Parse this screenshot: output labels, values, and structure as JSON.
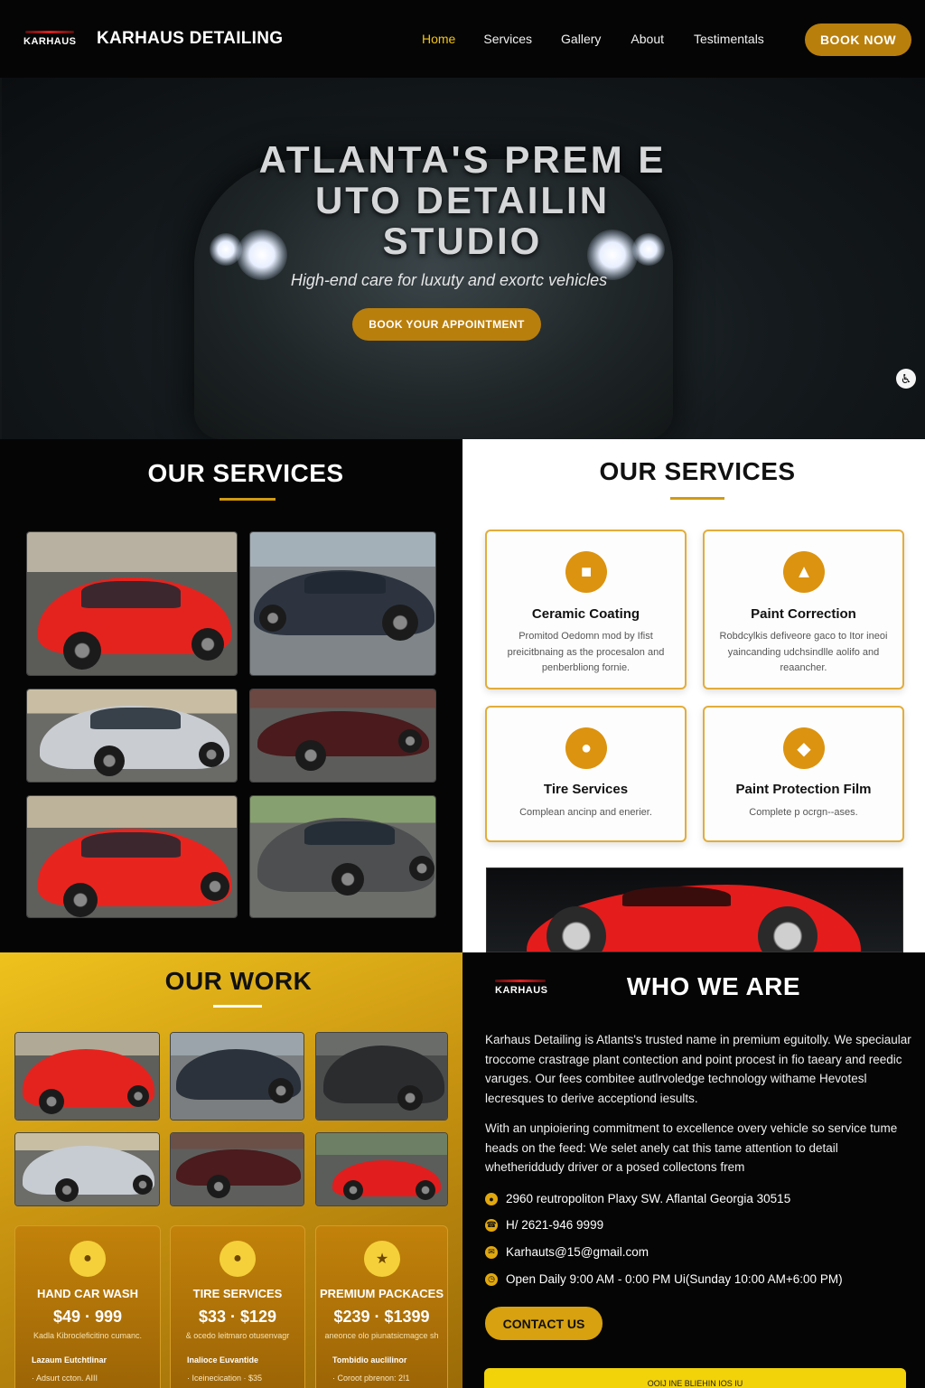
{
  "nav": {
    "logo_text": "KARHAUS",
    "brand": "KARHAUS DETAILING",
    "items": [
      {
        "label": "Home",
        "active": true
      },
      {
        "label": "Services",
        "active": false
      },
      {
        "label": "Gallery",
        "active": false
      },
      {
        "label": "About",
        "active": false
      },
      {
        "label": "Testimentals",
        "active": false
      }
    ],
    "cta": "BOOK NOW"
  },
  "hero": {
    "title_line1": "ATLANTA'S PREM  E",
    "title_line2": "UTO DETAILIN",
    "title_line3": "STUDIO",
    "subtitle": "High-end care for luxuty and exortc vehicles",
    "cta": "BOOK YOUR APPOINTMENT",
    "accessibility_icon": "accessibility-icon"
  },
  "services_left": {
    "title": "OUR SERVICES"
  },
  "services_right": {
    "title": "OUR SERVICES",
    "cards": [
      {
        "title": "Ceramic Coating",
        "desc": "Promitod Oedomn mod by Ifist preicitbnaing as the procesalon and penberbliong fornie.",
        "icon": "shield-icon"
      },
      {
        "title": "Paint Correction",
        "desc": "Robdcylkis defiveore gaco to Itor ineoi yaincanding udchsindlle aolifo and reaancher.",
        "icon": "spray-icon"
      },
      {
        "title": "Tire Services",
        "desc": "Complean ancinp and enerier.",
        "icon": "car-icon"
      },
      {
        "title": "Paint Protection Film",
        "desc": "Complete p ocrgn--ases.",
        "icon": "film-icon"
      }
    ]
  },
  "work": {
    "title": "OUR WORK",
    "packages": [
      {
        "name": "HAND CAR WASH",
        "price": "$49 · 999",
        "desc": "Kadla Kibrocleficitino cumanc.",
        "feature1": "Lazaum Eutchtlinar",
        "feature2": "·  Adsurt    ccton.   AIII",
        "icon": "wash-icon"
      },
      {
        "name": "TIRE SERVICES",
        "price": "$33 · $129",
        "desc": "& ocedo leitmaro otusenvagr",
        "feature1": "Inalioce Euvantide",
        "feature2": "·  Iceinecication    · $35",
        "icon": "tire-icon"
      },
      {
        "name": "PREMIUM PACKACES",
        "price": "$239 · $1399",
        "desc": "aneonce olo piunatsicmagce sh",
        "feature1": "Tombidio auclilinor",
        "feature2": "·  Coroot   pbrenon:   2!1",
        "icon": "star-icon"
      }
    ]
  },
  "who": {
    "logo_text": "KARHAUS",
    "title": "WHO WE ARE",
    "para1": "Karhaus Detailing is  Atlants's trusted name in premium eguitolly. We speciaular troccome crastrage  plant contection  and point procest in fio taeary and reedic varuges. Our fees combitee autlrvoledge  technology withame  Hevotesl lecresques to derive acceptiond iesults.",
    "para2": "With an unpioiering commitment to excellence  overy vehicle so service tume heads on the feed: We selet anely cat this tame attention to detail whetheriddudy driver or a posed collectons frem",
    "address": "2960 reutropoliton Plaxy SW. Aflantal Georgia 30515",
    "phone": "H/ 2621-946 9999",
    "email": "Karhauts@15@gmail.com",
    "hours": "Open Daily  9:00 AM  - 0:00 PM Ui(Sunday  10:00 AM+6:00 PM)",
    "cta": "CONTACT US",
    "footer_bar": "OOIJ INE BLIEHIN IOS IU"
  }
}
